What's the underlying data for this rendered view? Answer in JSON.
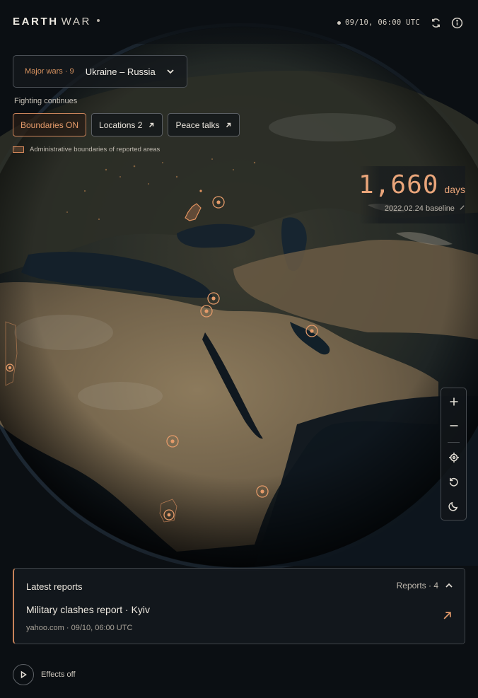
{
  "header": {
    "brand_primary": "EARTH",
    "brand_secondary": "WAR",
    "timestamp": "09/10, 06:00 UTC",
    "refresh_icon": "refresh-icon",
    "info_icon": "info-icon"
  },
  "selector": {
    "count_label": "Major wars · 9",
    "war_name": "Ukraine – Russia",
    "chevron_icon": "chevron-down-icon"
  },
  "status": "Fighting continues",
  "chips": [
    {
      "label": "Boundaries ON",
      "active": true
    },
    {
      "label": "Locations 2",
      "icon": "arrow-up-right-icon"
    },
    {
      "label": "Peace talks",
      "icon": "arrow-up-right-icon"
    }
  ],
  "legend": {
    "label": "Administrative boundaries of reported areas"
  },
  "days": {
    "value": "1,660",
    "unit": "days",
    "baseline": "2022.02.24 baseline"
  },
  "map_controls": [
    "zoom-in-icon",
    "zoom-out-icon",
    "locate-icon",
    "reset-rotation-icon",
    "night-mode-icon"
  ],
  "reports": {
    "title": "Latest reports",
    "count_label": "Reports · 4",
    "headline": "Military clashes report · Kyiv",
    "meta": "yahoo.com · 09/10, 06:00 UTC"
  },
  "effects": {
    "label": "Effects off"
  },
  "colors": {
    "accent": "#e59b6a",
    "background": "#0b0f13",
    "panel": "#14181c"
  }
}
